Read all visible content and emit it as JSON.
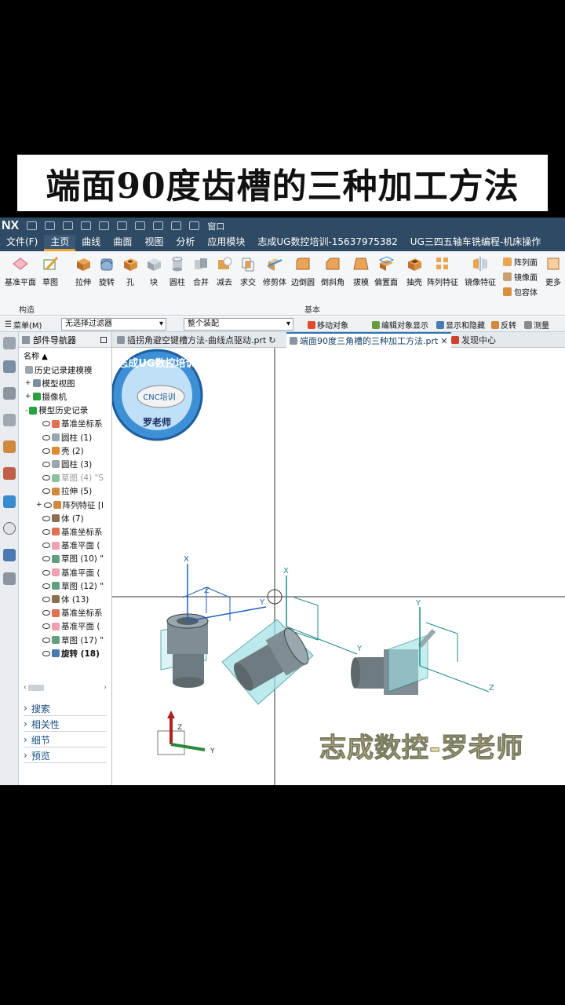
{
  "banner": {
    "title": "端面90度齿槽的三种加工方法"
  },
  "app": {
    "logo": "NX",
    "quick_access_window": "窗口",
    "menu_tabs": [
      "文件(F)",
      "主页",
      "曲线",
      "曲面",
      "视图",
      "分析",
      "应用模块",
      "志成UG数控培训-15637975382",
      "UG三四五轴车铣编程-机床操作"
    ],
    "ribbon": {
      "tools": [
        "基准平面",
        "草图",
        "拉伸",
        "旋转",
        "孔",
        "块",
        "圆柱",
        "合并",
        "减去",
        "求交",
        "修剪体",
        "边倒圆",
        "倒斜角",
        "拔模",
        "偏置面",
        "抽壳",
        "阵列特征",
        "镜像特征"
      ],
      "side_tools": [
        "阵列面",
        "镜像面",
        "包容体"
      ],
      "more": "更多",
      "group_construct": "构造",
      "group_basic": "基本"
    },
    "filter_bar": {
      "menu": "菜单(M)",
      "filter_value": "无选择过滤器",
      "assembly_value": "整个装配",
      "commands": [
        "移动对象",
        "编辑对象显示",
        "显示和隐藏",
        "反转",
        "测量"
      ]
    },
    "navigator": {
      "title": "部件导航器",
      "column": "名称",
      "rows": [
        "历史记录建模模",
        "模型视图",
        "摄像机",
        "模型历史记录",
        "基准坐标系",
        "圆柱 (1)",
        "壳 (2)",
        "圆柱 (3)",
        "草图 (4) \"S",
        "拉伸 (5)",
        "阵列特征 [l",
        "体 (7)",
        "基准坐标系",
        "基准平面 (",
        "草图 (10) \"",
        "基准平面 (",
        "草图 (12) \"",
        "体 (13)",
        "基准坐标系",
        "基准平面 (",
        "草图 (17) \"",
        "旋转 (18)"
      ],
      "panels": [
        "搜索",
        "相关性",
        "细节",
        "预览"
      ]
    },
    "doc_tabs": [
      "插拐角避空键槽方法-曲线点驱动.prt",
      "端面90度三角槽的三种加工方法.prt",
      "发现中心"
    ],
    "viewport": {
      "logo_top": "志成UG数控培训",
      "logo_mid": "CNC培训",
      "logo_bottom": "罗老师",
      "watermark": "志成数控-罗老师",
      "axis_labels": [
        "X",
        "Y",
        "Z"
      ]
    }
  },
  "colors": {
    "title_bar": "#2f4a64",
    "active_tab_underline": "#f2a12e",
    "part_gray": "#6e7b80",
    "datum_plane": "#9fe0e4",
    "axis_blue": "#1f5fbf",
    "axis_teal": "#1f8a8a"
  }
}
